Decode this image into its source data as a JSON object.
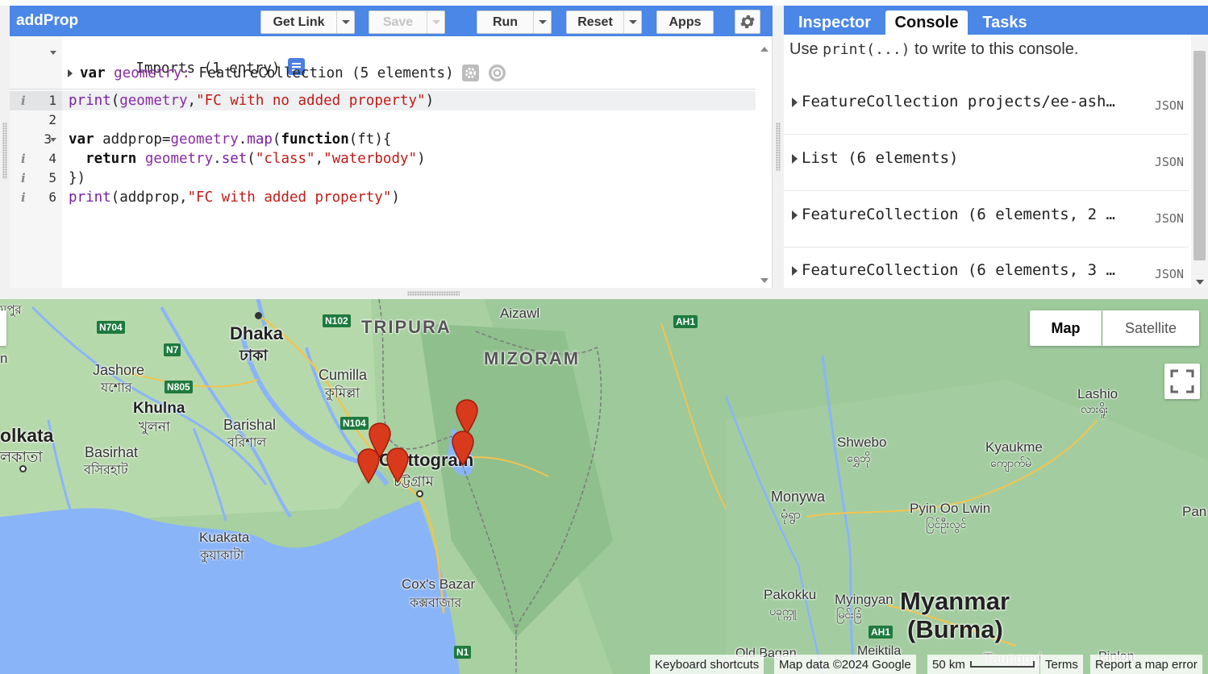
{
  "editor": {
    "script_title": "addProp",
    "toolbar": {
      "get_link": "Get Link",
      "save": "Save",
      "run": "Run",
      "reset": "Reset",
      "apps": "Apps"
    },
    "imports_header": "Imports (1 entry)",
    "import_var": {
      "keyword": "var",
      "name": "geometry:",
      "type": "FeatureCollection (5 elements)"
    },
    "lines": [
      {
        "number": "1",
        "tokens": [
          {
            "t": "print",
            "c": "fn"
          },
          {
            "t": "(",
            "c": ""
          },
          {
            "t": "geometry",
            "c": "purple"
          },
          {
            "t": ",",
            "c": ""
          },
          {
            "t": "\"FC with no added property\"",
            "c": "str"
          },
          {
            "t": ")",
            "c": ""
          }
        ]
      },
      {
        "number": "2",
        "tokens": []
      },
      {
        "number": "3",
        "tokens": [
          {
            "t": "var",
            "c": "kw"
          },
          {
            "t": " addprop=",
            "c": ""
          },
          {
            "t": "geometry",
            "c": "purple"
          },
          {
            "t": ".",
            "c": ""
          },
          {
            "t": "map",
            "c": "fn"
          },
          {
            "t": "(",
            "c": ""
          },
          {
            "t": "function",
            "c": "kw"
          },
          {
            "t": "(ft){",
            "c": ""
          }
        ]
      },
      {
        "number": "4",
        "tokens": [
          {
            "t": "  ",
            "c": ""
          },
          {
            "t": "return",
            "c": "kw"
          },
          {
            "t": " ",
            "c": ""
          },
          {
            "t": "geometry",
            "c": "purple"
          },
          {
            "t": ".",
            "c": ""
          },
          {
            "t": "set",
            "c": "fn"
          },
          {
            "t": "(",
            "c": ""
          },
          {
            "t": "\"class\"",
            "c": "str"
          },
          {
            "t": ",",
            "c": ""
          },
          {
            "t": "\"waterbody\"",
            "c": "str"
          },
          {
            "t": ")",
            "c": ""
          }
        ]
      },
      {
        "number": "5",
        "tokens": [
          {
            "t": "})",
            "c": ""
          }
        ]
      },
      {
        "number": "6",
        "tokens": [
          {
            "t": "print",
            "c": "fn"
          },
          {
            "t": "(addprop,",
            "c": ""
          },
          {
            "t": "\"FC with added property\"",
            "c": "str"
          },
          {
            "t": ")",
            "c": ""
          }
        ]
      }
    ]
  },
  "console": {
    "tabs": [
      "Inspector",
      "Console",
      "Tasks"
    ],
    "active_tab": "Console",
    "intro_prefix": "Use ",
    "intro_code": "print(...)",
    "intro_suffix": " to write to this console.",
    "outputs": [
      {
        "text": "FeatureCollection projects/ee-ash…",
        "json": "JSON"
      },
      {
        "text": "List (6 elements)",
        "json": "JSON"
      },
      {
        "text": "FeatureCollection (6 elements, 2 …",
        "json": "JSON"
      },
      {
        "text": "FeatureCollection (6 elements, 3 …",
        "json": "JSON"
      }
    ]
  },
  "map": {
    "map_type_buttons": [
      "Map",
      "Satellite"
    ],
    "selected_map_type": "Map",
    "places": [
      {
        "id": "dhaka",
        "name": "Dhaka",
        "local": "ঢাকা"
      },
      {
        "id": "jashore",
        "name": "Jashore",
        "local": "যশোর"
      },
      {
        "id": "khulna",
        "name": "Khulna",
        "local": "খুলনা"
      },
      {
        "id": "kolkata",
        "name": "olkata",
        "local": "লকাতা"
      },
      {
        "id": "basirhat",
        "name": "Basirhat",
        "local": "বসিরহাট"
      },
      {
        "id": "barishal",
        "name": "Barishal",
        "local": "বরিশাল"
      },
      {
        "id": "cumilla",
        "name": "Cumilla",
        "local": "কুমিল্লা"
      },
      {
        "id": "chittogram",
        "name": "Chittogram",
        "local": "চট্টগ্রাম"
      },
      {
        "id": "kuakata",
        "name": "Kuakata",
        "local": "কুয়াকাটা"
      },
      {
        "id": "coxs",
        "name": "Cox's Bazar",
        "local": "কক্সবাজার"
      },
      {
        "id": "aizawl",
        "name": "Aizawl",
        "local": ""
      },
      {
        "id": "shwebo",
        "name": "Shwebo",
        "local": "ရွှေဘို"
      },
      {
        "id": "monywa",
        "name": "Monywa",
        "local": "မုံရွာ"
      },
      {
        "id": "kyaukme",
        "name": "Kyaukme",
        "local": "ကျောက်မဲ"
      },
      {
        "id": "lashio",
        "name": "Lashio",
        "local": "လားရှိုး"
      },
      {
        "id": "pyinoolwin",
        "name": "Pyin Oo Lwin",
        "local": "ပြင်ဦးလွင်"
      },
      {
        "id": "pakokku",
        "name": "Pakokku",
        "local": "ပခုက္ကူ"
      },
      {
        "id": "myingyan",
        "name": "Myingyan",
        "local": "မြင်းခြံ"
      },
      {
        "id": "oldbagan",
        "name": "Old Bagan",
        "local": ""
      },
      {
        "id": "meiktila",
        "name": "Meiktila",
        "local": ""
      },
      {
        "id": "taunggyi",
        "name": "Taunggyi",
        "local": ""
      },
      {
        "id": "pinlon",
        "name": "Pinlon",
        "local": ""
      },
      {
        "id": "pan",
        "name": "Pan",
        "local": ""
      },
      {
        "id": "bhopur",
        "name": "মপুর",
        "local": ""
      },
      {
        "id": "n_edge",
        "name": "n",
        "local": ""
      }
    ],
    "regions": [
      "TRIPURA",
      "MIZORAM"
    ],
    "country": [
      "Myanmar",
      "(Burma)"
    ],
    "highways": [
      "N704",
      "N7",
      "N805",
      "N102",
      "N104",
      "AH1",
      "AH1",
      "N1"
    ],
    "attribution": {
      "shortcuts": "Keyboard shortcuts",
      "data": "Map data ©2024 Google",
      "scale": "50 km",
      "terms": "Terms",
      "report": "Report a map error"
    }
  },
  "colors": {
    "toolbar_blue": "#4a87e6",
    "marker_red": "#d93a1c",
    "water": "#8ab4f8",
    "land": "#9cc79a"
  }
}
